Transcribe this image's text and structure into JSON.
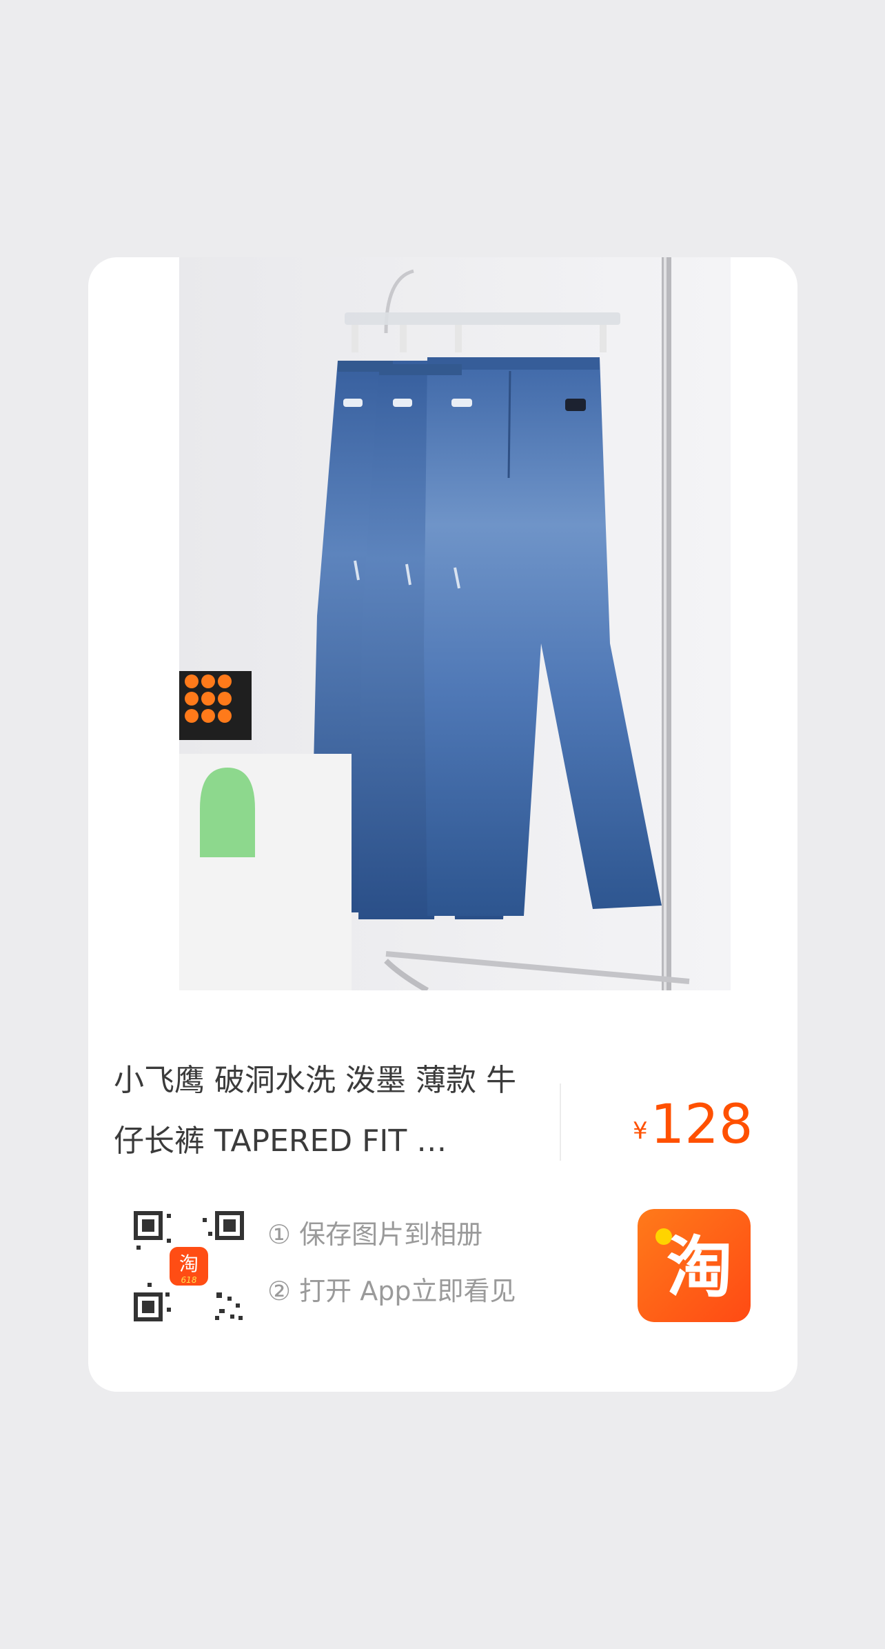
{
  "product": {
    "title": "小飞鹰 破洞水洗 泼墨 薄款 牛仔长裤 TAPERED FIT …",
    "currency": "¥",
    "price": "128"
  },
  "share": {
    "step1": "① 保存图片到相册",
    "step2": "② 打开 App立即看见",
    "qr_badge": "淘",
    "qr_badge_sub": "618",
    "app_logo_text": "淘"
  },
  "colors": {
    "background": "#ececee",
    "card": "#ffffff",
    "price": "#ff5000",
    "brand_orange": "#ff5a14",
    "text": "#3b3b3b",
    "hint": "#9a9a9a"
  },
  "icons": {
    "qr": "qr-code-icon",
    "app": "taobao-app-icon"
  }
}
